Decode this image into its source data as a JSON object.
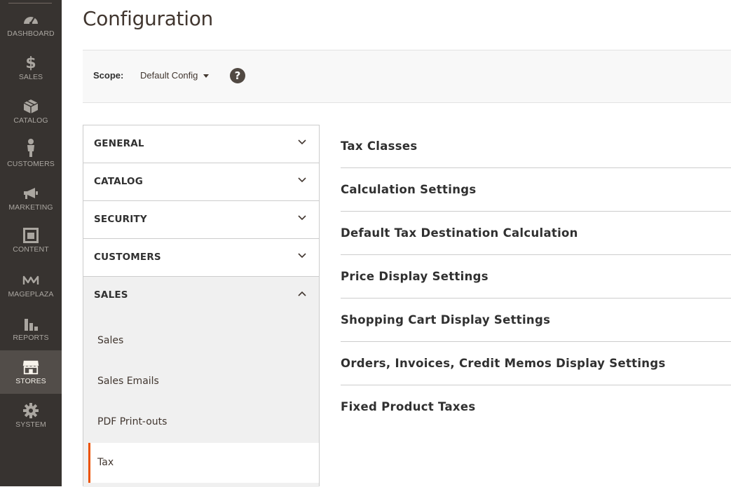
{
  "menu": {
    "items": [
      {
        "label": "DASHBOARD",
        "icon": "dashboard-icon"
      },
      {
        "label": "SALES",
        "icon": "dollar-icon"
      },
      {
        "label": "CATALOG",
        "icon": "box-icon"
      },
      {
        "label": "CUSTOMERS",
        "icon": "person-icon"
      },
      {
        "label": "MARKETING",
        "icon": "megaphone-icon"
      },
      {
        "label": "CONTENT",
        "icon": "layout-icon"
      },
      {
        "label": "MAGEPLAZA",
        "icon": "mageplaza-icon"
      },
      {
        "label": "REPORTS",
        "icon": "bar-chart-icon"
      },
      {
        "label": "STORES",
        "icon": "store-icon"
      },
      {
        "label": "SYSTEM",
        "icon": "gear-icon"
      }
    ],
    "active": "STORES"
  },
  "page": {
    "title": "Configuration"
  },
  "scope": {
    "label": "Scope:",
    "value": "Default Config",
    "help_icon": "question-icon",
    "help_glyph": "?"
  },
  "config_nav": {
    "sections": [
      {
        "title": "GENERAL",
        "expanded": false
      },
      {
        "title": "CATALOG",
        "expanded": false
      },
      {
        "title": "SECURITY",
        "expanded": false
      },
      {
        "title": "CUSTOMERS",
        "expanded": false
      },
      {
        "title": "SALES",
        "expanded": true
      }
    ],
    "sales_items": [
      {
        "label": "Sales"
      },
      {
        "label": "Sales Emails"
      },
      {
        "label": "PDF Print-outs"
      },
      {
        "label": "Tax",
        "current": true
      }
    ]
  },
  "fieldsets": [
    {
      "title": "Tax Classes"
    },
    {
      "title": "Calculation Settings"
    },
    {
      "title": "Default Tax Destination Calculation"
    },
    {
      "title": "Price Display Settings"
    },
    {
      "title": "Shopping Cart Display Settings"
    },
    {
      "title": "Orders, Invoices, Credit Memos Display Settings"
    },
    {
      "title": "Fixed Product Taxes"
    }
  ],
  "colors": {
    "menu_bg": "#373330",
    "menu_active_bg": "#524d49",
    "accent": "#eb5202",
    "scope_bar_bg": "#f8f8f8",
    "nav_open_bg": "#f0f0f0"
  }
}
